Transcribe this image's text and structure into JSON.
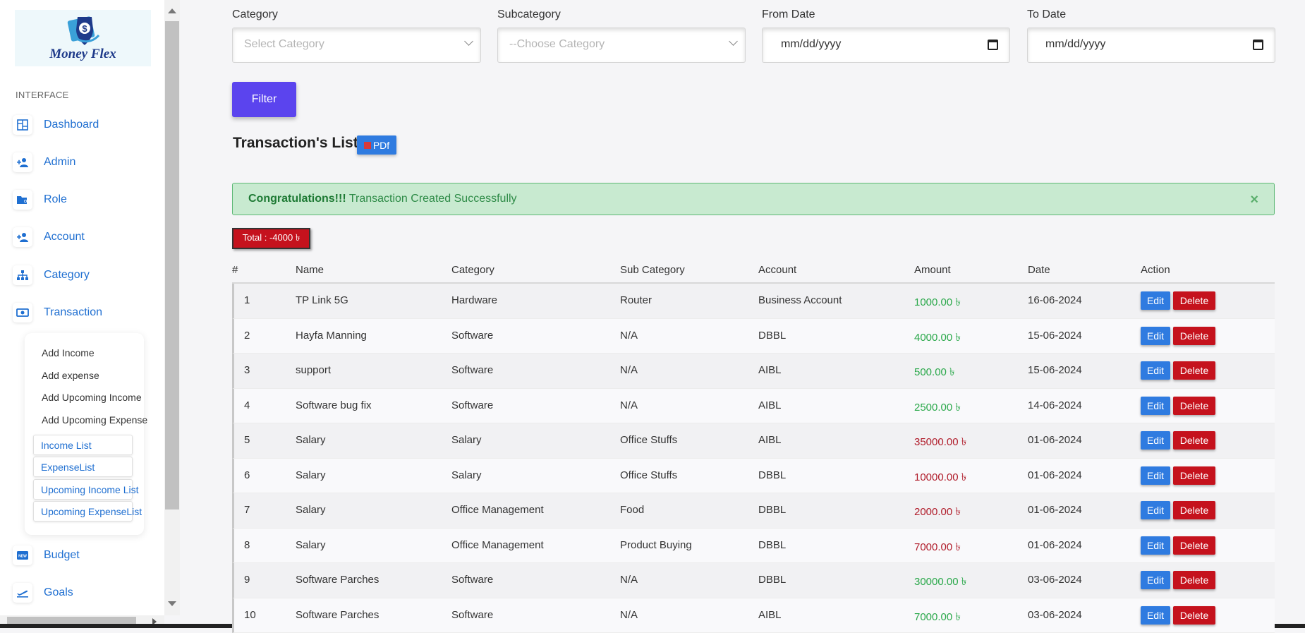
{
  "brand": {
    "name": "Money Flex"
  },
  "sidebar": {
    "section_label": "INTERFACE",
    "items": [
      {
        "label": "Dashboard",
        "icon": "dashboard-icon"
      },
      {
        "label": "Admin",
        "icon": "user-plus-icon"
      },
      {
        "label": "Role",
        "icon": "folder-user-icon"
      },
      {
        "label": "Account",
        "icon": "user-plus-icon"
      },
      {
        "label": "Category",
        "icon": "sitemap-icon"
      },
      {
        "label": "Transaction",
        "icon": "money-bill-icon"
      },
      {
        "label": "Budget",
        "icon": "new-badge-icon"
      },
      {
        "label": "Goals",
        "icon": "plane-departure-icon"
      }
    ],
    "submenu": {
      "actions": [
        "Add Income",
        "Add expense",
        "Add Upcoming Income",
        "Add Upcoming Expense"
      ],
      "links": [
        "Income List",
        "ExpenseList",
        "Upcoming Income List",
        "Upcoming ExpenseList"
      ]
    }
  },
  "filters": {
    "category": {
      "label": "Category",
      "placeholder": "Select Category"
    },
    "subcategory": {
      "label": "Subcategory",
      "placeholder": "--Choose Category"
    },
    "from_date": {
      "label": "From Date",
      "value": "mm/dd/yyyy"
    },
    "to_date": {
      "label": "To Date",
      "value": "mm/dd/yyyy"
    },
    "button": "Filter"
  },
  "list": {
    "title": "Transaction's List",
    "pdf_label": "PDf",
    "alert_strong": "Congratulations!!!",
    "alert_text": " Transaction Created Successfully",
    "alert_close": "×",
    "total": "Total : -4000 ৳"
  },
  "table": {
    "headers": [
      "#",
      "Name",
      "Category",
      "Sub Category",
      "Account",
      "Amount",
      "Date",
      "Action"
    ],
    "edit_label": "Edit",
    "delete_label": "Delete",
    "rows": [
      {
        "num": "1",
        "name": "TP Link 5G",
        "category": "Hardware",
        "sub": "Router",
        "account": "Business Account",
        "amount": "1000.00 ৳",
        "type": "income",
        "date": "16-06-2024"
      },
      {
        "num": "2",
        "name": "Hayfa Manning",
        "category": "Software",
        "sub": "N/A",
        "account": "DBBL",
        "amount": "4000.00 ৳",
        "type": "income",
        "date": "15-06-2024"
      },
      {
        "num": "3",
        "name": "support",
        "category": "Software",
        "sub": "N/A",
        "account": "AIBL",
        "amount": "500.00 ৳",
        "type": "income",
        "date": "15-06-2024"
      },
      {
        "num": "4",
        "name": "Software bug fix",
        "category": "Software",
        "sub": "N/A",
        "account": "AIBL",
        "amount": "2500.00 ৳",
        "type": "income",
        "date": "14-06-2024"
      },
      {
        "num": "5",
        "name": "Salary",
        "category": "Salary",
        "sub": "Office Stuffs",
        "account": "AIBL",
        "amount": "35000.00 ৳",
        "type": "expense",
        "date": "01-06-2024"
      },
      {
        "num": "6",
        "name": "Salary",
        "category": "Salary",
        "sub": "Office Stuffs",
        "account": "DBBL",
        "amount": "10000.00 ৳",
        "type": "expense",
        "date": "01-06-2024"
      },
      {
        "num": "7",
        "name": "Salary",
        "category": "Office Management",
        "sub": "Food",
        "account": "DBBL",
        "amount": "2000.00 ৳",
        "type": "expense",
        "date": "01-06-2024"
      },
      {
        "num": "8",
        "name": "Salary",
        "category": "Office Management",
        "sub": "Product Buying",
        "account": "DBBL",
        "amount": "7000.00 ৳",
        "type": "expense",
        "date": "01-06-2024"
      },
      {
        "num": "9",
        "name": "Software Parches",
        "category": "Software",
        "sub": "N/A",
        "account": "DBBL",
        "amount": "30000.00 ৳",
        "type": "income",
        "date": "03-06-2024"
      },
      {
        "num": "10",
        "name": "Software Parches",
        "category": "Software",
        "sub": "N/A",
        "account": "AIBL",
        "amount": "7000.00 ৳",
        "type": "income",
        "date": "03-06-2024"
      }
    ]
  },
  "colors": {
    "accent": "#5b44ee",
    "link": "#1f6fd1",
    "edit": "#2f7be0",
    "delete": "#c5121d",
    "income": "#2aa84a",
    "expense": "#b01c2a"
  }
}
